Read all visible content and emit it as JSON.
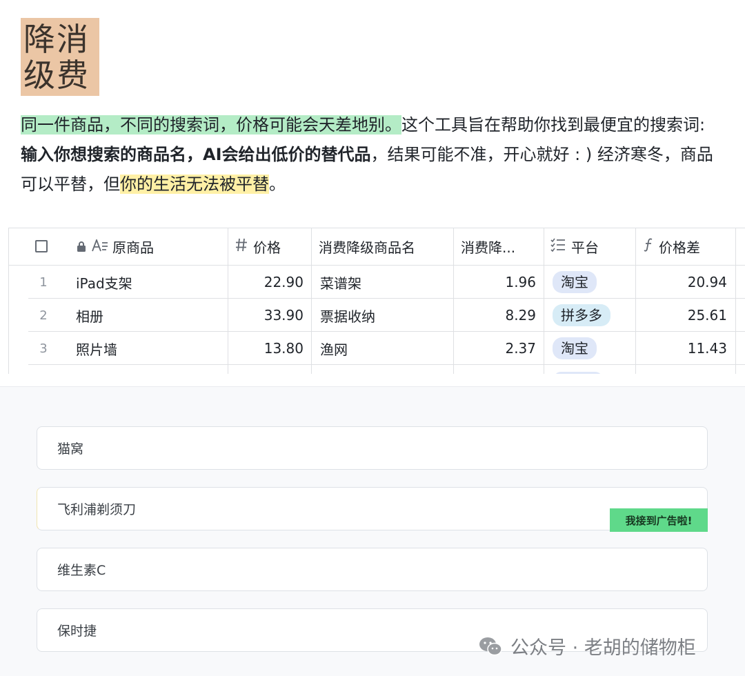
{
  "logo": {
    "line1": "降消",
    "line2": "级费"
  },
  "intro": {
    "seg1": "同一件商品，不同的搜索词，价格可能会天差地别。",
    "seg2": "这个工具旨在帮助你找到最便宜的搜索词: ",
    "seg3": "输入你想搜索的商品名，AI会给出低价的替代品",
    "seg4": "，结果可能不准，开心就好 : ) 经济寒冬，商品可以平替，但",
    "seg5": "你的生活无法被平替",
    "seg6": "。"
  },
  "table": {
    "headers": {
      "original": "原商品",
      "price": "价格",
      "downgrade_name": "消费降级商品名",
      "downgrade_price": "消费降...",
      "platform": "平台",
      "diff": "价格差"
    },
    "icons": {
      "lock": "lock-icon",
      "text_field": "text-field-icon",
      "number": "hash-icon",
      "select": "list-icon",
      "formula": "formula-icon"
    },
    "rows": [
      {
        "idx": "1",
        "original": "iPad支架",
        "price": "22.90",
        "downgrade_name": "菜谱架",
        "downgrade_price": "1.96",
        "platform": "淘宝",
        "diff": "20.94"
      },
      {
        "idx": "2",
        "original": "相册",
        "price": "33.90",
        "downgrade_name": "票据收纳",
        "downgrade_price": "8.29",
        "platform": "拼多多",
        "diff": "25.61"
      },
      {
        "idx": "3",
        "original": "照片墙",
        "price": "13.80",
        "downgrade_name": "渔网",
        "downgrade_price": "2.37",
        "platform": "淘宝",
        "diff": "11.43"
      }
    ]
  },
  "inputs": [
    {
      "value": "猫窝"
    },
    {
      "value": "飞利浦剃须刀"
    },
    {
      "value": "维生素C"
    },
    {
      "value": "保时捷"
    }
  ],
  "ad_badge": "我接到广告啦!",
  "watermark": "公众号 · 老胡的储物柜"
}
